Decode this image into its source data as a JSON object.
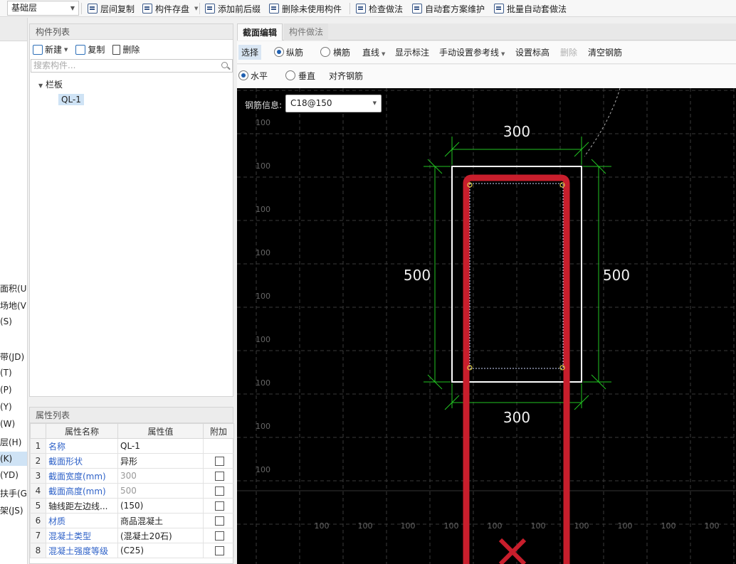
{
  "toolbar": {
    "floor": "基础层",
    "buttons": [
      "层间复制",
      "构件存盘",
      "添加前后缀",
      "删除未使用构件",
      "检查做法",
      "自动套方案维护",
      "批量自动套做法"
    ]
  },
  "left_strip": {
    "items": [
      "面积(U",
      "场地(V",
      "(S)",
      "带(JD)",
      "(T)",
      "(P)",
      "(Y)",
      "(W)",
      "层(H)",
      "(K)",
      "(YD)",
      "扶手(G",
      "架(JS)"
    ],
    "selected": "(K)"
  },
  "component_list": {
    "title": "构件列表",
    "new_label": "新建",
    "copy_label": "复制",
    "delete_label": "删除",
    "search_placeholder": "搜索构件...",
    "tree_parent": "栏板",
    "tree_child": "QL-1"
  },
  "properties": {
    "title": "属性列表",
    "headers": [
      "属性名称",
      "属性值",
      "附加"
    ],
    "rows": [
      {
        "idx": "1",
        "name": "名称",
        "value": "QL-1"
      },
      {
        "idx": "2",
        "name": "截面形状",
        "value": "异形"
      },
      {
        "idx": "3",
        "name": "截面宽度(mm)",
        "value": "300"
      },
      {
        "idx": "4",
        "name": "截面高度(mm)",
        "value": "500"
      },
      {
        "idx": "5",
        "name": "轴线距左边线...",
        "value": "(150)"
      },
      {
        "idx": "6",
        "name": "材质",
        "value": "商品混凝土"
      },
      {
        "idx": "7",
        "name": "混凝土类型",
        "value": "(混凝土20石)"
      },
      {
        "idx": "8",
        "name": "混凝土强度等级",
        "value": "(C25)"
      }
    ]
  },
  "editor": {
    "tabs": [
      "截面编辑",
      "构件做法"
    ],
    "bar1": {
      "select": "选择",
      "longitudinal": "纵筋",
      "transverse": "横筋",
      "line": "直线",
      "show_label": "显示标注",
      "manual_ref": "手动设置参考线",
      "set_elev": "设置标高",
      "delete": "删除",
      "clear": "清空钢筋"
    },
    "bar2": {
      "horizontal": "水平",
      "vertical": "垂直",
      "align": "对齐钢筋"
    },
    "rebar_info_label": "钢筋信息:",
    "rebar_value": "C18@150",
    "grid_label": "100",
    "dims": {
      "top": "300",
      "bottom": "300",
      "left": "500",
      "right": "500"
    },
    "colors": {
      "canvas": "#000000",
      "rebar": "#c81e2c",
      "dimension": "#22c322",
      "section": "#ffffff",
      "grid": "#3a3a3a"
    }
  }
}
